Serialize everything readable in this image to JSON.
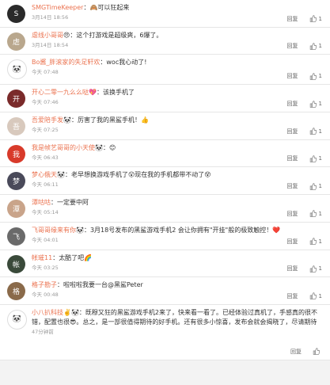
{
  "comments": [
    {
      "name": "SMGTimeKeeper",
      "sep": "：",
      "emo": "🙈",
      "text": "可以狂起来",
      "time": "3月14日 18:56",
      "reply": "回复",
      "likes": "1",
      "avatar_color": "#2a2a2a",
      "avatar_glyph": "S"
    },
    {
      "name": "虐线小哥哥",
      "sep": "",
      "emo": "😠",
      "text": "：这个打游戏是超级爽，6爆了。",
      "time": "3月14日 18:54",
      "reply": "回复",
      "likes": "1",
      "avatar_color": "#b9a78d",
      "avatar_glyph": "虐"
    },
    {
      "name": "Bo酱_胖滚家的失足轩欢",
      "sep": "：",
      "emo": "",
      "text": "woc我心动了!",
      "time": "今天 07:48",
      "reply": "回复",
      "likes": "1",
      "avatar_color": "#ffffff",
      "avatar_glyph": "🐼"
    },
    {
      "name": "开心二零一九么么哒",
      "sep": "",
      "emo": "💖",
      "text": "：该换手机了",
      "time": "今天 07:46",
      "reply": "回复",
      "likes": "1",
      "avatar_color": "#7a2a2a",
      "avatar_glyph": "开"
    },
    {
      "name": "吾爱陪手发",
      "sep": "",
      "emo": "🐼",
      "text": "：厉害了我的黑鲨手机！👍",
      "time": "今天 07:25",
      "reply": "回复",
      "likes": "1",
      "avatar_color": "#d8c9bd",
      "avatar_glyph": "吾"
    },
    {
      "name": "我是帧艺哥哥的小天使",
      "sep": "",
      "emo": "🐼",
      "text": "：😊",
      "time": "今天 06:43",
      "reply": "回复",
      "likes": "1",
      "avatar_color": "#d83a2a",
      "avatar_glyph": "我"
    },
    {
      "name": "梦心俄天",
      "sep": "",
      "emo": "🐼",
      "text": "：老早想换游戏手机了😲现在我的手机都带不动了😵",
      "time": "今天 06:11",
      "reply": "回复",
      "likes": "1",
      "avatar_color": "#4a4a5a",
      "avatar_glyph": "梦"
    },
    {
      "name": "潭咕咕",
      "sep": "：",
      "emo": "",
      "text": "一定要中阿",
      "time": "今天 05:14",
      "reply": "回复",
      "likes": "1",
      "avatar_color": "#c9a48a",
      "avatar_glyph": "潭"
    },
    {
      "name": "飞哥哥缘来有你",
      "sep": "",
      "emo": "🐼",
      "text": "：3月18号发布的黑鲨游戏手机2 会让你拥有\"开挂\"般的极致触控！❤️",
      "time": "今天 04:01",
      "reply": "回复",
      "likes": "1",
      "avatar_color": "#6a6a6a",
      "avatar_glyph": "飞"
    },
    {
      "name": "帐璀11",
      "sep": "：",
      "emo": "",
      "text": "太酷了吧🌈",
      "time": "今天 03:25",
      "reply": "回复",
      "likes": "1",
      "avatar_color": "#3a4a3a",
      "avatar_glyph": "帐"
    },
    {
      "name": "格子勘子",
      "sep": "：",
      "emo": "",
      "text": "啦啦啦我要一台@黑鲨Peter",
      "time": "今天 00:48",
      "reply": "回复",
      "likes": "1",
      "avatar_color": "#8a6a4a",
      "avatar_glyph": "格"
    },
    {
      "name": "小八扒科技",
      "sep": "",
      "emo": "✌️🐼",
      "text": "：既穆又狂的黑鲨游戏手机2来了，快来看一看了。已经体验过真机了，手感真的很不错，配置也很😎。总之，是一部很值得期待的好手机。还有很多小惊喜，发布会就会揭晓了，尽请期待",
      "time": "47分钟前",
      "reply": "回复",
      "likes": "",
      "avatar_color": "#ffffff",
      "avatar_glyph": "🐼"
    }
  ]
}
